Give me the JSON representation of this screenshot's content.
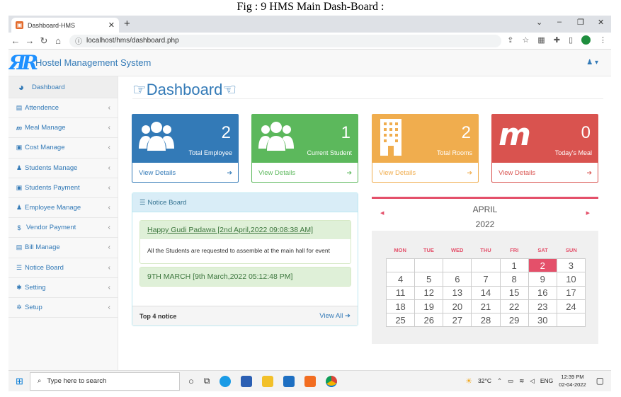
{
  "caption": "Fig : 9 HMS Main Dash-Board :",
  "browser": {
    "tab_title": "Dashboard-HMS",
    "url": "localhost/hms/dashboard.php"
  },
  "app": {
    "title": "Hostel Management System"
  },
  "sidebar": {
    "items": [
      {
        "label": "Dashboard"
      },
      {
        "label": "Attendence"
      },
      {
        "label": "Meal Manage"
      },
      {
        "label": "Cost Manage"
      },
      {
        "label": "Students Manage"
      },
      {
        "label": "Students Payment"
      },
      {
        "label": "Employee Manage"
      },
      {
        "label": "Vendor Payment"
      },
      {
        "label": "Bill Manage"
      },
      {
        "label": "Notice Board"
      },
      {
        "label": "Setting"
      },
      {
        "label": "Setup"
      }
    ]
  },
  "page": {
    "title": "Dashboard"
  },
  "cards": [
    {
      "value": "2",
      "label": "Total Employee",
      "link": "View Details",
      "color": "#337ab7"
    },
    {
      "value": "1",
      "label": "Current Student",
      "link": "View Details",
      "color": "#5cb85c"
    },
    {
      "value": "2",
      "label": "Total Rooms",
      "link": "View Details",
      "color": "#f0ad4e"
    },
    {
      "value": "0",
      "label": "Today's Meal",
      "link": "View Details",
      "color": "#d9534f"
    }
  ],
  "notice": {
    "header": "Notice Board",
    "items": [
      {
        "title": "Happy Gudi Padawa [2nd April,2022 09:08:38 AM]",
        "body": "All the Students are requested to assemble at the main hall for event"
      },
      {
        "title": "9TH MARCH  [9th March,2022 05:12:48 PM]"
      }
    ],
    "footer": "Top 4 notice",
    "view_all": "View All"
  },
  "calendar": {
    "month": "APRIL",
    "year": "2022",
    "days": [
      "MON",
      "TUE",
      "WED",
      "THU",
      "FRI",
      "SAT",
      "SUN"
    ],
    "weeks": [
      [
        "",
        "",
        "",
        "",
        "1",
        "2",
        "3"
      ],
      [
        "4",
        "5",
        "6",
        "7",
        "8",
        "9",
        "10"
      ],
      [
        "11",
        "12",
        "13",
        "14",
        "15",
        "16",
        "17"
      ],
      [
        "18",
        "19",
        "20",
        "21",
        "22",
        "23",
        "24"
      ],
      [
        "25",
        "26",
        "27",
        "28",
        "29",
        "30",
        ""
      ]
    ],
    "today": "2"
  },
  "taskbar": {
    "search_placeholder": "Type here to search",
    "temp": "32°C",
    "lang": "ENG",
    "time": "12:39 PM",
    "date": "02-04-2022"
  }
}
